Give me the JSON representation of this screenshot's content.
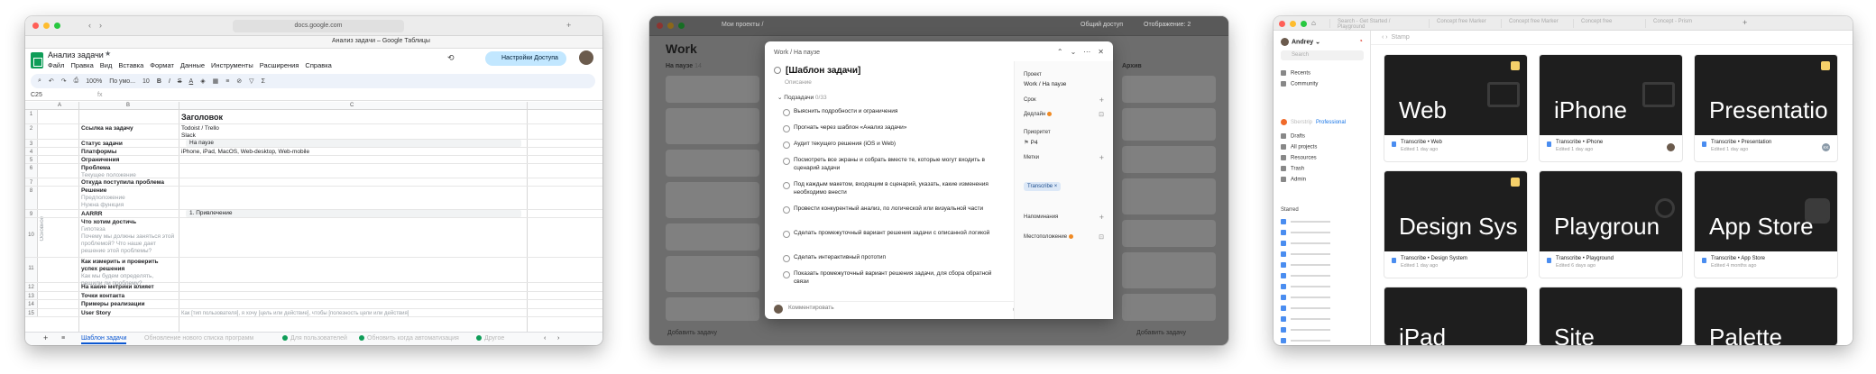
{
  "sheets": {
    "url": "docs.google.com",
    "tab_title": "Анализ задачи – Google Таблицы",
    "doc_title": "Анализ задачи",
    "menu": [
      "Файл",
      "Правка",
      "Вид",
      "Вставка",
      "Формат",
      "Данные",
      "Инструменты",
      "Расширения",
      "Справка"
    ],
    "share_label": "Настройки Доступа",
    "toolbar": {
      "zoom": "100%",
      "font": "По умо...",
      "font_size": "10"
    },
    "cell_ref": "C25",
    "fx": "fx",
    "columns": [
      "A",
      "B",
      "C"
    ],
    "rows": [
      {
        "num": "1",
        "b": "",
        "c": "Заголовок"
      },
      {
        "num": "2",
        "b": "Ссылка на задачу",
        "c": "Todoist / Trello\nSlack"
      },
      {
        "num": "3",
        "b": "Статус задачи",
        "c": "На паузе"
      },
      {
        "num": "4",
        "b": "Платформы",
        "c": "iPhone, iPad, MacOS, Web-desktop, Web-mobile"
      },
      {
        "num": "5",
        "b": "Ограничения",
        "c": ""
      },
      {
        "num": "6",
        "b": "Проблема",
        "b_sub": "Текущее положение",
        "c": ""
      },
      {
        "num": "7",
        "b": "Откуда поступила проблема",
        "c": ""
      },
      {
        "num": "8",
        "b": "Решение",
        "b_sub": "Предположение\nНужна функция",
        "c": ""
      },
      {
        "num": "9",
        "b": "AARRR",
        "c": "1. Привлечение"
      },
      {
        "num": "10",
        "b": "Что хотим достичь",
        "b_sub": "Гипотеза\nПочему мы должны заняться этой проблемой? Что наше дает решение этой проблемы?",
        "c": ""
      },
      {
        "num": "11",
        "b": "Как измерить и проверить успех решения",
        "b_sub": "Как мы будем определять, решили ли проблему?",
        "c": ""
      },
      {
        "num": "12",
        "b": "На какие метрики влияет",
        "c": ""
      },
      {
        "num": "13",
        "b": "Точки контакта",
        "c": ""
      },
      {
        "num": "14",
        "b": "Примеры реализации",
        "c": ""
      },
      {
        "num": "15",
        "b": "User Story",
        "c": "Как [тип пользователя], я хочу [цель или действие], чтобы [полезность цели или действия]"
      }
    ],
    "side_label": "Основное",
    "sheet_tabs": {
      "plus": "+",
      "list": "≡",
      "active": "Шаблон задачи",
      "others": [
        "Обновление нового списка программ",
        "Для пользователей",
        "Обновить когда автоматизация",
        "Другое"
      ]
    }
  },
  "tasks": {
    "breadcrumb": "Мои проекты /",
    "share": "Общий доступ",
    "display": "Отображение: 2",
    "workspace_title": "Work",
    "columns": [
      {
        "title": "На паузе",
        "count": "14"
      },
      {
        "title": "Архив",
        "count": ""
      }
    ],
    "add_task": "Добавить задачу",
    "modal": {
      "breadcrumb": "Work / На паузе",
      "title": "[Шаблон задачи]",
      "description": "Описание",
      "subtasks_label": "Подзадачи",
      "subtasks_count": "0/33",
      "subtasks": [
        "Выяснить подробности и ограничения",
        "Прогнать через шаблон «Анализ задачи»",
        "Аудит текущего решения (iOS и Web)",
        "Посмотреть все экраны и собрать вместе те, которые могут входить в сценарий задачи",
        "Под каждым макетом, входящим в сценарий, указать, какие изменения необходимо внести",
        "Провести конкурентный анализ, по логической или визуальной части",
        "Сделать промежуточный вариант решения задачи с описанной логикой",
        "Сделать интерактивный прототип",
        "Показать промежуточный вариант решения задачи, для сбора обратной связи"
      ],
      "comment_placeholder": "Комментировать",
      "side": {
        "project_label": "Проект",
        "project_value": "Work / На паузе",
        "due_label": "Срок",
        "deadline_label": "Дедлайн",
        "priority_label": "Приоритет",
        "priority_value": "P4",
        "labels_label": "Метки",
        "tag": "Transcribe",
        "reminders_label": "Напоминания",
        "location_label": "Местоположение"
      }
    }
  },
  "figma": {
    "tabs": [
      "Search - Get Started / Playground",
      "Concept free Marker",
      "Concept free Marker",
      "Concept free",
      "Concept - Prism"
    ],
    "user": "Andrey",
    "search": "Search",
    "nav": [
      "Recents",
      "Community"
    ],
    "team": "Sberstrip",
    "plan": "Professional",
    "nav2": [
      "Drafts",
      "All projects",
      "Resources",
      "Trash",
      "Admin"
    ],
    "starred_label": "Starred",
    "breadcrumb": "Stamp",
    "cards": [
      {
        "big": "Web",
        "name": "Transcribe • Web",
        "edited": "Edited 1 day ago",
        "avatar": ""
      },
      {
        "big": "iPhone",
        "name": "Transcribe • iPhone",
        "edited": "Edited 1 day ago",
        "avatar": ""
      },
      {
        "big": "Presentatio",
        "name": "Transcribe • Presentation",
        "edited": "Edited 1 day ago",
        "avatar": "KK"
      },
      {
        "big": "Design Sys",
        "name": "Transcribe • Design System",
        "edited": "Edited 1 day ago",
        "avatar": ""
      },
      {
        "big": "Playgroun",
        "name": "Transcribe • Playground",
        "edited": "Edited 6 days ago",
        "avatar": ""
      },
      {
        "big": "App Store",
        "name": "Transcribe • App Store",
        "edited": "Edited 4 months ago",
        "avatar": ""
      },
      {
        "big": "iPad",
        "name": "",
        "edited": "",
        "avatar": ""
      },
      {
        "big": "Site",
        "name": "",
        "edited": "",
        "avatar": ""
      },
      {
        "big": "Palette",
        "name": "",
        "edited": "",
        "avatar": ""
      }
    ]
  }
}
